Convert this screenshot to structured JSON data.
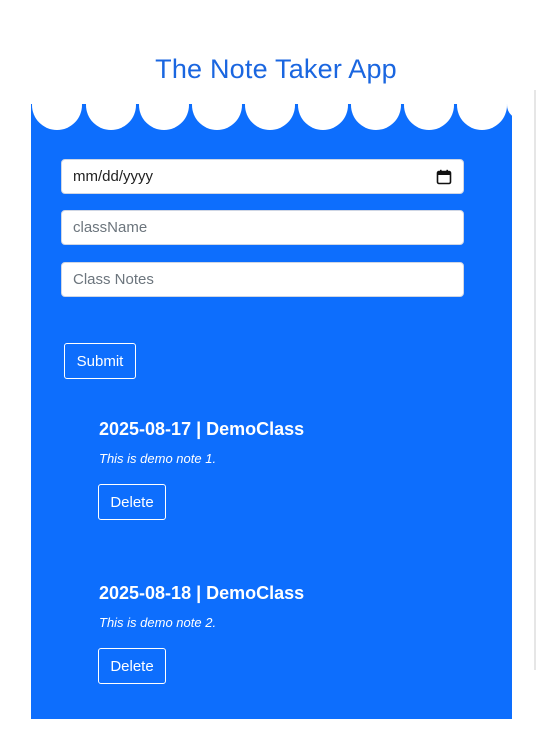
{
  "app": {
    "title": "The Note Taker App"
  },
  "form": {
    "date_placeholder": "mm/dd/yyyy",
    "class_placeholder": "className",
    "notes_placeholder": "Class Notes",
    "submit_label": "Submit"
  },
  "notes": [
    {
      "heading": "2025-08-17 | DemoClass",
      "body": "This is demo note 1.",
      "delete_label": "Delete"
    },
    {
      "heading": "2025-08-18 | DemoClass",
      "body": "This is demo note 2.",
      "delete_label": "Delete"
    }
  ],
  "colors": {
    "panel": "#0d6efd",
    "title": "#1a66e0"
  },
  "icons": {
    "date_picker": "calendar-icon"
  }
}
